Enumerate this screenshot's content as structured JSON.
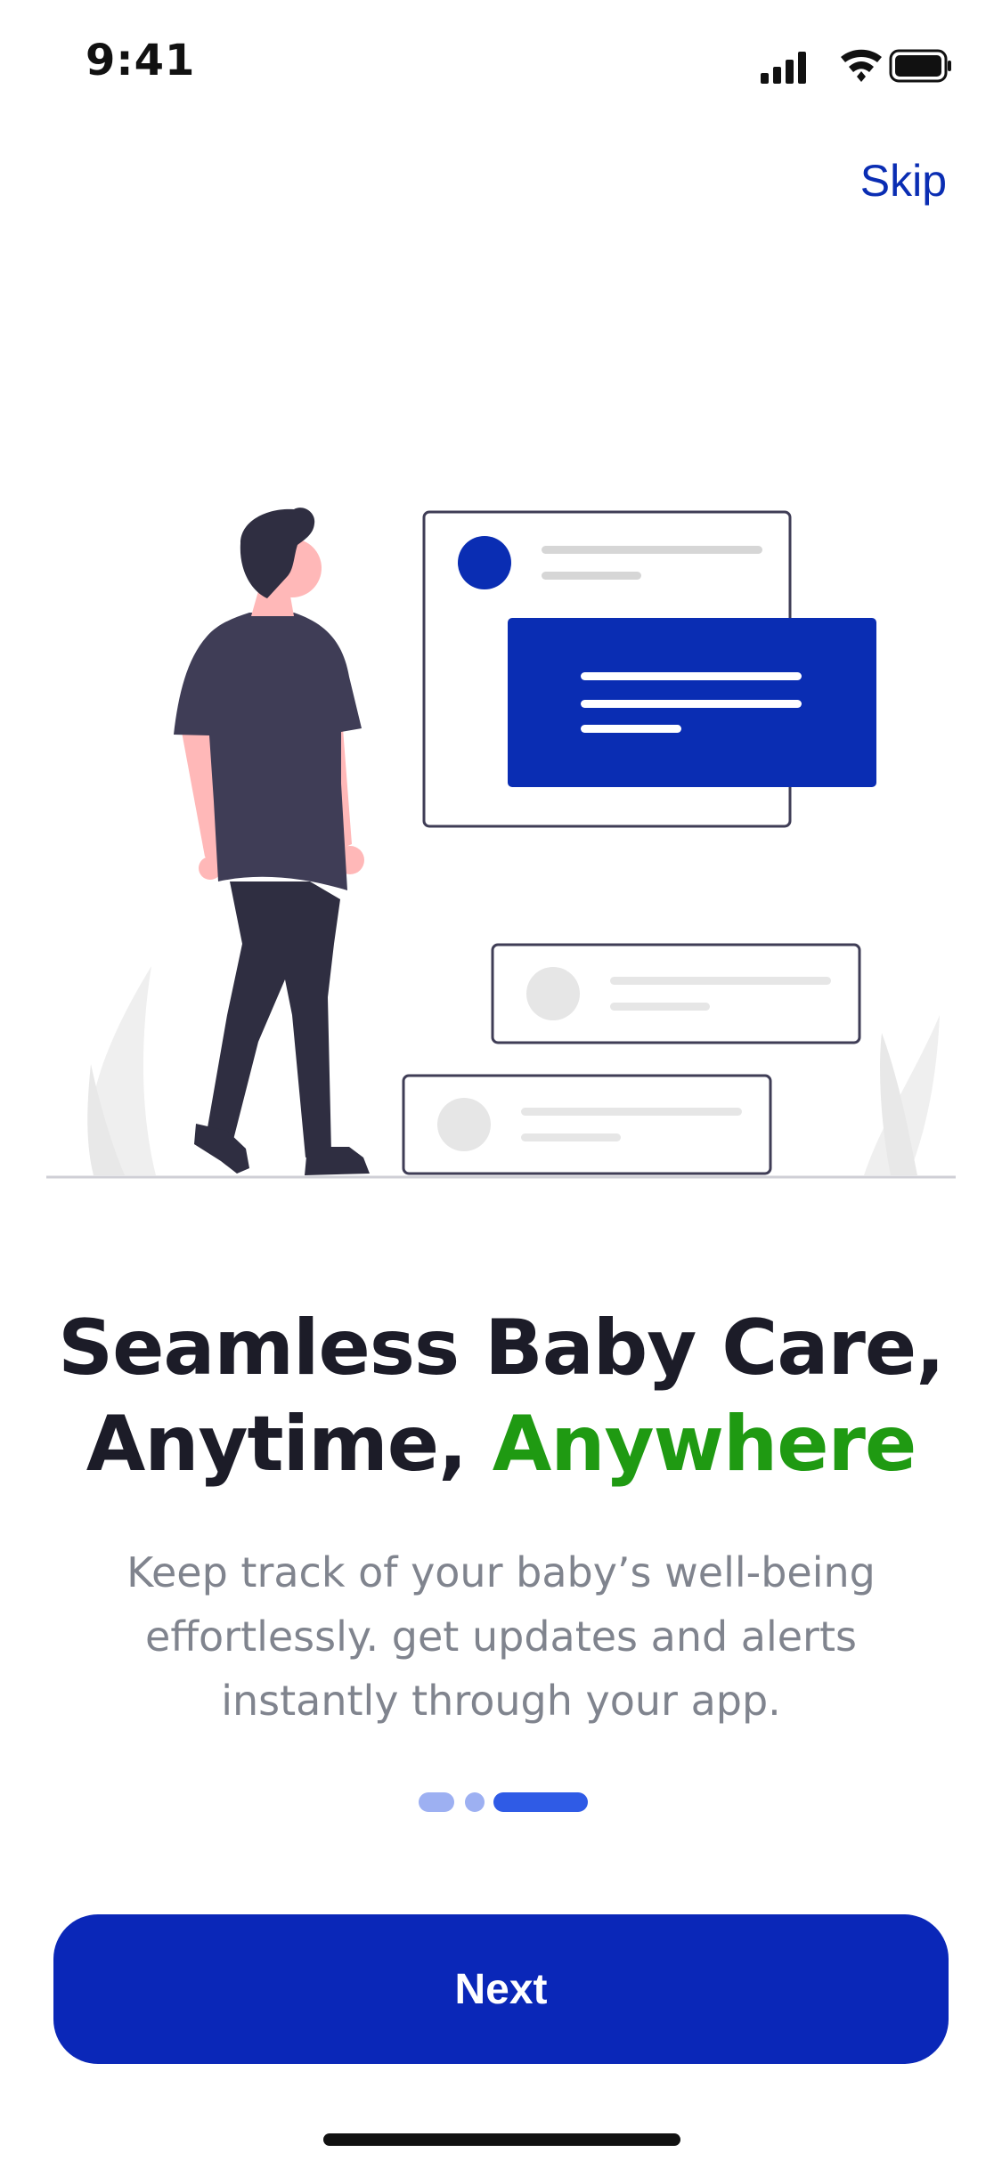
{
  "status_bar": {
    "time": "9:41"
  },
  "header": {
    "skip_label": "Skip"
  },
  "onboarding": {
    "title_line1": "Seamless Baby Care,",
    "title_line2_prefix": "Anytime, ",
    "title_line2_accent": "Anywhere",
    "description": "Keep track of your baby’s well-being effortlessly. get updates and alerts instantly through your app.",
    "page_count": 3,
    "active_page": 3
  },
  "actions": {
    "next_label": "Next"
  },
  "colors": {
    "brand_blue": "#0a27b8",
    "accent_green": "#1f9a12",
    "title_dark": "#1c1c28",
    "body_gray": "#80848e"
  },
  "icons": [
    "signal-icon",
    "wifi-icon",
    "battery-icon"
  ]
}
